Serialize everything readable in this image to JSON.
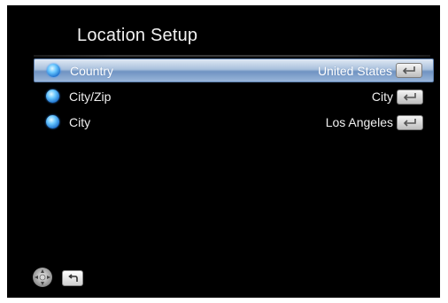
{
  "screen": {
    "title": "Location Setup"
  },
  "settings": [
    {
      "label": "Country",
      "value": "United States",
      "selected": true,
      "icon": "enter-icon"
    },
    {
      "label": "City/Zip",
      "value": "City",
      "selected": false,
      "icon": "enter-icon"
    },
    {
      "label": "City",
      "value": "Los Angeles",
      "selected": false,
      "icon": "enter-icon"
    }
  ],
  "footer": {
    "nav_icon": "navigation-pad-icon",
    "back_icon": "back-return-icon"
  },
  "colors": {
    "background": "#000000",
    "selection_top": "#dfe8f3",
    "selection_bottom": "#6f93c2",
    "bullet": "#67c6ff",
    "text": "#f0f0f0"
  }
}
